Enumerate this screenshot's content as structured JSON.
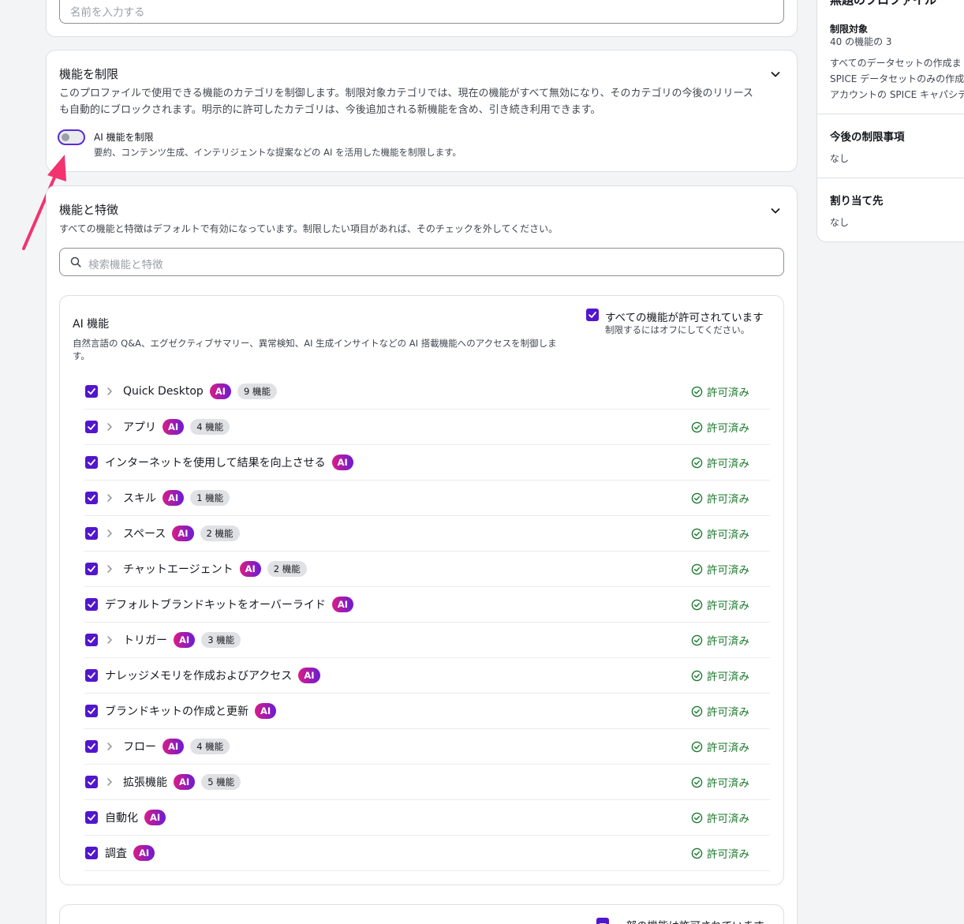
{
  "name_field": {
    "placeholder": "名前を入力する"
  },
  "restrict_section": {
    "title": "機能を制限",
    "description": "このプロファイルで使用できる機能のカテゴリを制御します。制限対象カテゴリでは、現在の機能がすべて無効になり、そのカテゴリの今後のリリースも自動的にブロックされます。明示的に許可したカテゴリは、今後追加される新機能を含め、引き続き利用できます。",
    "toggle_label": "AI 機能を制限",
    "toggle_description": "要約、コンテンツ生成、インテリジェントな提案などの AI を活用した機能を制限します。",
    "toggle_on": false
  },
  "features_section": {
    "title": "機能と特徴",
    "description": "すべての機能と特徴はデフォルトで有効になっています。制限したい項目があれば、そのチェックを外してください。",
    "search_placeholder": "検索機能と特徴"
  },
  "ai_card": {
    "title": "AI 機能",
    "description_line1": "自然言語の Q&A、エグゼクティブサマリー、異常検知、AI 生成インサイトなどの AI 搭載機能へのアクセスを制御しま",
    "description_line2": "す。",
    "all_allowed_label": "すべての機能が許可されています",
    "all_allowed_hint": "制限するにはオフにしてください。",
    "ai_badge": "AI",
    "status_label": "許可済み",
    "items": [
      {
        "label": "Quick Desktop",
        "count": "9 機能",
        "expandable": true
      },
      {
        "label": "アプリ",
        "count": "4 機能",
        "expandable": true
      },
      {
        "label": "インターネットを使用して結果を向上させる",
        "count": "",
        "expandable": false
      },
      {
        "label": "スキル",
        "count": "1 機能",
        "expandable": true
      },
      {
        "label": "スペース",
        "count": "2 機能",
        "expandable": true
      },
      {
        "label": "チャットエージェント",
        "count": "2 機能",
        "expandable": true
      },
      {
        "label": "デフォルトブランドキットをオーバーライド",
        "count": "",
        "expandable": false
      },
      {
        "label": "トリガー",
        "count": "3 機能",
        "expandable": true
      },
      {
        "label": "ナレッジメモリを作成およびアクセス",
        "count": "",
        "expandable": false
      },
      {
        "label": "ブランドキットの作成と更新",
        "count": "",
        "expandable": false
      },
      {
        "label": "フロー",
        "count": "4 機能",
        "expandable": true
      },
      {
        "label": "拡張機能",
        "count": "5 機能",
        "expandable": true
      },
      {
        "label": "自動化",
        "count": "",
        "expandable": false
      },
      {
        "label": "調査",
        "count": "",
        "expandable": false
      }
    ]
  },
  "next_card": {
    "partial_label": "一部の機能は許可されています"
  },
  "sidebar": {
    "heading": "無題のプロファイル",
    "restricted_title": "制限対象",
    "restricted_value": "40 の機能の 3",
    "restricted_lines": [
      "すべてのデータセットの作成ま",
      "SPICE データセットのみの作成",
      "アカウントの SPICE キャパシテ"
    ],
    "future_title": "今後の制限事項",
    "future_value": "なし",
    "assign_title": "割り当て先",
    "assign_value": "なし"
  },
  "colors": {
    "accent": "#5216cc",
    "allowed_green": "#1d7a2e",
    "annotation_arrow": "#f2336f"
  }
}
